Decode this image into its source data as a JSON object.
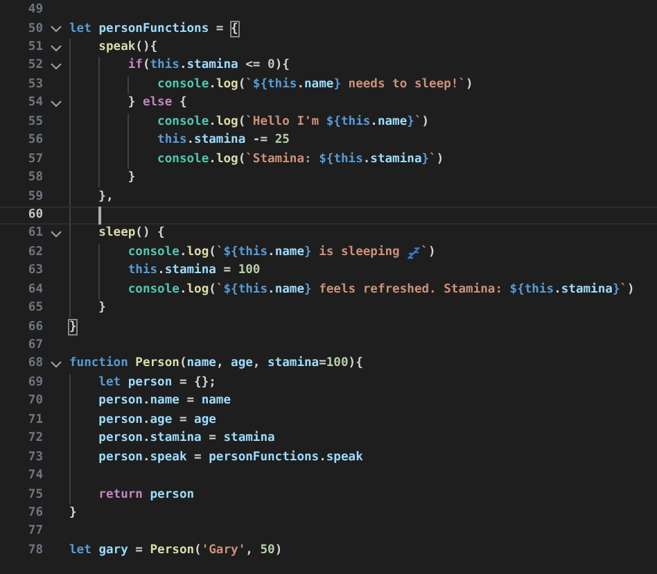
{
  "editor": {
    "lines": [
      {
        "number": "49",
        "current": false
      },
      {
        "number": "50",
        "current": false,
        "collapsed": false,
        "tokens": [
          {
            "text": "let ",
            "kind": "kw"
          },
          {
            "text": "personFunctions",
            "kind": "var"
          },
          {
            "text": " = ",
            "kind": "punc"
          },
          {
            "text": "{",
            "kind": "bracket"
          }
        ]
      },
      {
        "number": "51",
        "current": false,
        "collapsed": false,
        "tokens": [
          {
            "text": "    speak",
            "kind": "fn"
          },
          {
            "text": "(){",
            "kind": "punc"
          }
        ]
      },
      {
        "number": "52",
        "current": false,
        "collapsed": false,
        "tokens": [
          {
            "text": "        if",
            "kind": "ctl"
          },
          {
            "text": "(",
            "kind": "punc"
          },
          {
            "text": "this",
            "kind": "kw"
          },
          {
            "text": ".",
            "kind": "punc"
          },
          {
            "text": "stamina",
            "kind": "var"
          },
          {
            "text": " <= ",
            "kind": "punc"
          },
          {
            "text": "0",
            "kind": "num"
          },
          {
            "text": "){",
            "kind": "punc"
          }
        ]
      },
      {
        "number": "53",
        "current": false,
        "tokens": [
          {
            "text": "            console",
            "kind": "cls"
          },
          {
            "text": ".",
            "kind": "punc"
          },
          {
            "text": "log",
            "kind": "fn"
          },
          {
            "text": "(",
            "kind": "punc"
          },
          {
            "text": "`",
            "kind": "str"
          },
          {
            "text": "${",
            "kind": "tmpl"
          },
          {
            "text": "this",
            "kind": "kw"
          },
          {
            "text": ".",
            "kind": "punc"
          },
          {
            "text": "name",
            "kind": "var"
          },
          {
            "text": "}",
            "kind": "tmpl"
          },
          {
            "text": " needs to sleep!`",
            "kind": "str"
          },
          {
            "text": ")",
            "kind": "punc"
          }
        ]
      },
      {
        "number": "54",
        "current": false,
        "collapsed": false,
        "tokens": [
          {
            "text": "        } ",
            "kind": "punc"
          },
          {
            "text": "else",
            "kind": "ctl"
          },
          {
            "text": " {",
            "kind": "punc"
          }
        ]
      },
      {
        "number": "55",
        "current": false,
        "tokens": [
          {
            "text": "            console",
            "kind": "cls"
          },
          {
            "text": ".",
            "kind": "punc"
          },
          {
            "text": "log",
            "kind": "fn"
          },
          {
            "text": "(",
            "kind": "punc"
          },
          {
            "text": "`Hello I'm ",
            "kind": "str"
          },
          {
            "text": "${",
            "kind": "tmpl"
          },
          {
            "text": "this",
            "kind": "kw"
          },
          {
            "text": ".",
            "kind": "punc"
          },
          {
            "text": "name",
            "kind": "var"
          },
          {
            "text": "}",
            "kind": "tmpl"
          },
          {
            "text": "`",
            "kind": "str"
          },
          {
            "text": ")",
            "kind": "punc"
          }
        ]
      },
      {
        "number": "56",
        "current": false,
        "tokens": [
          {
            "text": "            this",
            "kind": "kw"
          },
          {
            "text": ".",
            "kind": "punc"
          },
          {
            "text": "stamina",
            "kind": "var"
          },
          {
            "text": " -= ",
            "kind": "punc"
          },
          {
            "text": "25",
            "kind": "num"
          }
        ]
      },
      {
        "number": "57",
        "current": false,
        "tokens": [
          {
            "text": "            console",
            "kind": "cls"
          },
          {
            "text": ".",
            "kind": "punc"
          },
          {
            "text": "log",
            "kind": "fn"
          },
          {
            "text": "(",
            "kind": "punc"
          },
          {
            "text": "`Stamina: ",
            "kind": "str"
          },
          {
            "text": "${",
            "kind": "tmpl"
          },
          {
            "text": "this",
            "kind": "kw"
          },
          {
            "text": ".",
            "kind": "punc"
          },
          {
            "text": "stamina",
            "kind": "var"
          },
          {
            "text": "}",
            "kind": "tmpl"
          },
          {
            "text": "`",
            "kind": "str"
          },
          {
            "text": ")",
            "kind": "punc"
          }
        ]
      },
      {
        "number": "58",
        "current": false,
        "tokens": [
          {
            "text": "        }",
            "kind": "punc"
          }
        ]
      },
      {
        "number": "59",
        "current": false,
        "tokens": [
          {
            "text": "    },",
            "kind": "punc"
          }
        ]
      },
      {
        "number": "60",
        "current": true
      },
      {
        "number": "61",
        "current": false,
        "collapsed": false,
        "tokens": [
          {
            "text": "    sleep",
            "kind": "fn"
          },
          {
            "text": "() {",
            "kind": "punc"
          }
        ]
      },
      {
        "number": "62",
        "current": false,
        "tokens": [
          {
            "text": "        console",
            "kind": "cls"
          },
          {
            "text": ".",
            "kind": "punc"
          },
          {
            "text": "log",
            "kind": "fn"
          },
          {
            "text": "(",
            "kind": "punc"
          },
          {
            "text": "`",
            "kind": "str"
          },
          {
            "text": "${",
            "kind": "tmpl"
          },
          {
            "text": "this",
            "kind": "kw"
          },
          {
            "text": ".",
            "kind": "punc"
          },
          {
            "text": "name",
            "kind": "var"
          },
          {
            "text": "}",
            "kind": "tmpl"
          },
          {
            "text": " is sleeping ",
            "kind": "str"
          },
          {
            "kind": "icon"
          },
          {
            "text": "`",
            "kind": "str"
          },
          {
            "text": ")",
            "kind": "punc"
          }
        ]
      },
      {
        "number": "63",
        "current": false,
        "tokens": [
          {
            "text": "        this",
            "kind": "kw"
          },
          {
            "text": ".",
            "kind": "punc"
          },
          {
            "text": "stamina",
            "kind": "var"
          },
          {
            "text": " = ",
            "kind": "punc"
          },
          {
            "text": "100",
            "kind": "num"
          }
        ]
      },
      {
        "number": "64",
        "current": false,
        "tokens": [
          {
            "text": "        console",
            "kind": "cls"
          },
          {
            "text": ".",
            "kind": "punc"
          },
          {
            "text": "log",
            "kind": "fn"
          },
          {
            "text": "(",
            "kind": "punc"
          },
          {
            "text": "`",
            "kind": "str"
          },
          {
            "text": "${",
            "kind": "tmpl"
          },
          {
            "text": "this",
            "kind": "kw"
          },
          {
            "text": ".",
            "kind": "punc"
          },
          {
            "text": "name",
            "kind": "var"
          },
          {
            "text": "}",
            "kind": "tmpl"
          },
          {
            "text": " feels refreshed. Stamina: ",
            "kind": "str"
          },
          {
            "text": "${",
            "kind": "tmpl"
          },
          {
            "text": "this",
            "kind": "kw"
          },
          {
            "text": ".",
            "kind": "punc"
          },
          {
            "text": "stamina",
            "kind": "var"
          },
          {
            "text": "}",
            "kind": "tmpl"
          },
          {
            "text": "`",
            "kind": "str"
          },
          {
            "text": ")",
            "kind": "punc"
          }
        ]
      },
      {
        "number": "65",
        "current": false,
        "tokens": [
          {
            "text": "    }",
            "kind": "punc"
          }
        ]
      },
      {
        "number": "66",
        "current": false,
        "tokens": [
          {
            "text": "}",
            "kind": "bracket"
          }
        ]
      },
      {
        "number": "67",
        "current": false
      },
      {
        "number": "68",
        "current": false,
        "collapsed": false,
        "tokens": [
          {
            "text": "function ",
            "kind": "kw"
          },
          {
            "text": "Person",
            "kind": "fn"
          },
          {
            "text": "(",
            "kind": "punc"
          },
          {
            "text": "name",
            "kind": "var"
          },
          {
            "text": ", ",
            "kind": "punc"
          },
          {
            "text": "age",
            "kind": "var"
          },
          {
            "text": ", ",
            "kind": "punc"
          },
          {
            "text": "stamina",
            "kind": "var"
          },
          {
            "text": "=",
            "kind": "punc"
          },
          {
            "text": "100",
            "kind": "num"
          },
          {
            "text": "){",
            "kind": "punc"
          }
        ]
      },
      {
        "number": "69",
        "current": false,
        "tokens": [
          {
            "text": "    let ",
            "kind": "kw"
          },
          {
            "text": "person",
            "kind": "var"
          },
          {
            "text": " = {};",
            "kind": "punc"
          }
        ]
      },
      {
        "number": "70",
        "current": false,
        "tokens": [
          {
            "text": "    person",
            "kind": "var"
          },
          {
            "text": ".",
            "kind": "punc"
          },
          {
            "text": "name",
            "kind": "var"
          },
          {
            "text": " = ",
            "kind": "punc"
          },
          {
            "text": "name",
            "kind": "var"
          }
        ]
      },
      {
        "number": "71",
        "current": false,
        "tokens": [
          {
            "text": "    person",
            "kind": "var"
          },
          {
            "text": ".",
            "kind": "punc"
          },
          {
            "text": "age",
            "kind": "var"
          },
          {
            "text": " = ",
            "kind": "punc"
          },
          {
            "text": "age",
            "kind": "var"
          }
        ]
      },
      {
        "number": "72",
        "current": false,
        "tokens": [
          {
            "text": "    person",
            "kind": "var"
          },
          {
            "text": ".",
            "kind": "punc"
          },
          {
            "text": "stamina",
            "kind": "var"
          },
          {
            "text": " = ",
            "kind": "punc"
          },
          {
            "text": "stamina",
            "kind": "var"
          }
        ]
      },
      {
        "number": "73",
        "current": false,
        "tokens": [
          {
            "text": "    person",
            "kind": "var"
          },
          {
            "text": ".",
            "kind": "punc"
          },
          {
            "text": "speak",
            "kind": "var"
          },
          {
            "text": " = ",
            "kind": "punc"
          },
          {
            "text": "personFunctions",
            "kind": "var"
          },
          {
            "text": ".",
            "kind": "punc"
          },
          {
            "text": "speak",
            "kind": "var"
          }
        ]
      },
      {
        "number": "74",
        "current": false
      },
      {
        "number": "75",
        "current": false,
        "tokens": [
          {
            "text": "    return ",
            "kind": "ctl"
          },
          {
            "text": "person",
            "kind": "var"
          }
        ]
      },
      {
        "number": "76",
        "current": false,
        "tokens": [
          {
            "text": "}",
            "kind": "punc"
          }
        ]
      },
      {
        "number": "77",
        "current": false
      },
      {
        "number": "78",
        "current": false,
        "tokens": [
          {
            "text": "let ",
            "kind": "kw"
          },
          {
            "text": "gary",
            "kind": "var"
          },
          {
            "text": " = ",
            "kind": "punc"
          },
          {
            "text": "Person",
            "kind": "fn"
          },
          {
            "text": "(",
            "kind": "punc"
          },
          {
            "text": "'Gary'",
            "kind": "str"
          },
          {
            "text": ", ",
            "kind": "punc"
          },
          {
            "text": "50",
            "kind": "num"
          },
          {
            "text": ")",
            "kind": "punc"
          }
        ]
      }
    ]
  }
}
